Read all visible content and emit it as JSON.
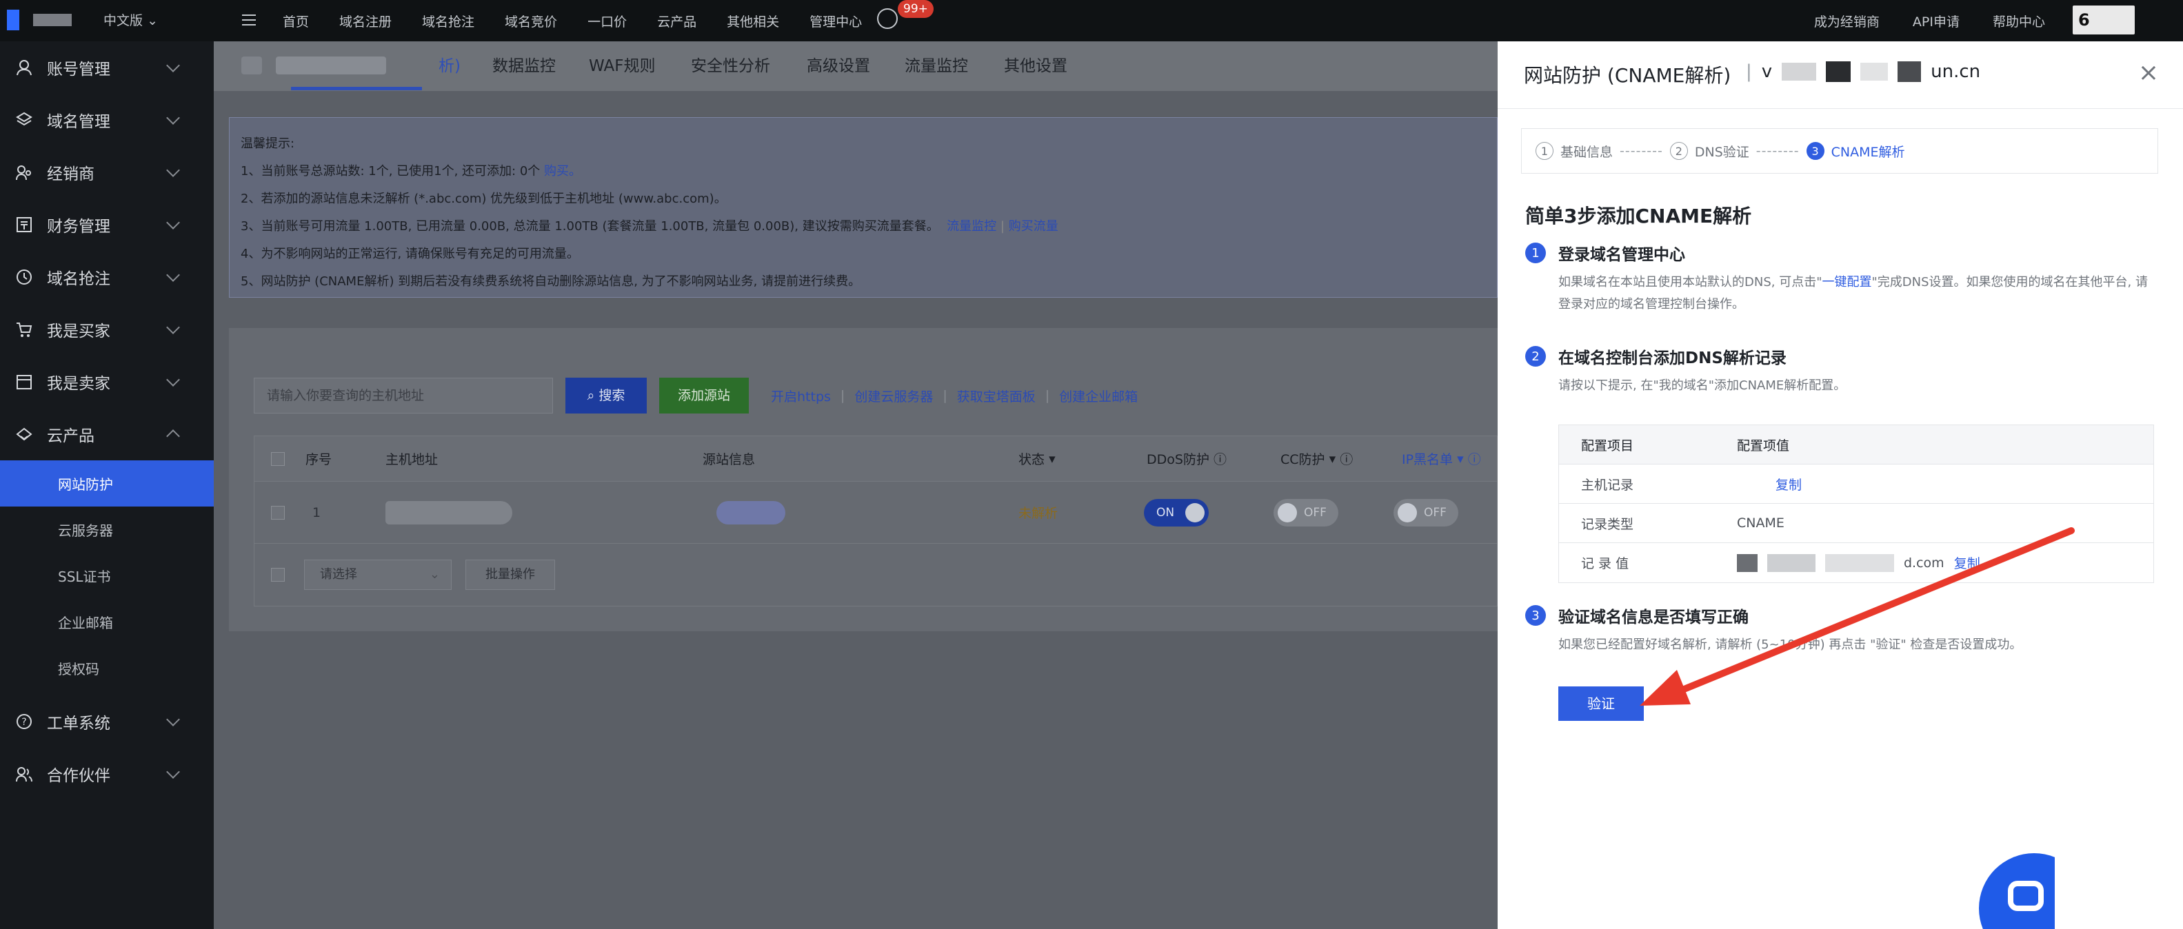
{
  "topbar": {
    "lang": "中文版",
    "nav": [
      "首页",
      "域名注册",
      "域名抢注",
      "域名竞价",
      "一口价",
      "云产品",
      "其他相关",
      "管理中心"
    ],
    "badge": "99+",
    "right_links": [
      "成为经销商",
      "API申请",
      "帮助中心"
    ],
    "avatar_text": "6"
  },
  "sidebar": {
    "items": [
      {
        "label": "账号管理",
        "icon": "user-icon"
      },
      {
        "label": "域名管理",
        "icon": "layers-icon"
      },
      {
        "label": "经销商",
        "icon": "people-icon"
      },
      {
        "label": "财务管理",
        "icon": "finance-icon"
      },
      {
        "label": "域名抢注",
        "icon": "clock-icon"
      },
      {
        "label": "我是买家",
        "icon": "cart-icon"
      },
      {
        "label": "我是卖家",
        "icon": "store-icon"
      },
      {
        "label": "云产品",
        "icon": "cloud-icon"
      }
    ],
    "sub_items": [
      "网站防护",
      "云服务器",
      "SSL证书",
      "企业邮箱",
      "授权码"
    ],
    "bottom_items": [
      {
        "label": "工单系统",
        "icon": "question-icon"
      },
      {
        "label": "合作伙伴",
        "icon": "partner-icon"
      }
    ]
  },
  "tabs": {
    "first_tab_suffix": "析)",
    "items": [
      "数据监控",
      "WAF规则",
      "安全性分析",
      "高级设置",
      "流量监控",
      "其他设置"
    ]
  },
  "tips": {
    "title": "温馨提示:",
    "lines": [
      "1、当前账号总源站数: 1个, 已使用1个, 还可添加: 0个",
      "2、若添加的源站信息未泛解析 (*.abc.com) 优先级到低于主机地址 (www.abc.com)。",
      "3、当前账号可用流量 1.00TB, 已用流量 0.00B, 总流量 1.00TB (套餐流量 1.00TB, 流量包 0.00B), 建议按需购买流量套餐。",
      "4、为不影响网站的正常运行, 请确保账号有充足的可用流量。",
      "5、网站防护 (CNAME解析) 到期后若没有续费系统将自动删除源站信息, 为了不影响网站业务, 请提前进行续费。"
    ],
    "buy_link": "购买。",
    "traffic_link": "流量监控",
    "buy_traffic_link": "购买流量"
  },
  "toolbar": {
    "search_placeholder": "请输入你要查询的主机地址",
    "search_label": "搜索",
    "add_label": "添加源站",
    "links": [
      "开启https",
      "创建云服务器",
      "获取宝塔面板",
      "创建企业邮箱"
    ]
  },
  "table": {
    "headers": [
      "序号",
      "主机地址",
      "源站信息",
      "状态",
      "DDoS防护",
      "CC防护",
      "IP黑名单"
    ],
    "row": {
      "index": "1",
      "status": "未解析",
      "ddos": "ON",
      "cc": "OFF",
      "ip": "OFF"
    },
    "select_placeholder": "请选择",
    "batch_label": "批量操作"
  },
  "drawer": {
    "title": "网站防护 (CNAME解析)",
    "domain_prefix": "v",
    "domain_suffix": "un.cn",
    "steps": [
      {
        "num": "1",
        "label": "基础信息"
      },
      {
        "num": "2",
        "label": "DNS验证"
      },
      {
        "num": "3",
        "label": "CNAME解析"
      }
    ],
    "step_separator": "--------",
    "section_title": "简单3步添加CNAME解析",
    "step1": {
      "num": "1",
      "title": "登录域名管理中心",
      "desc_before": "如果域名在本站且使用本站默认的DNS, 可点击\"",
      "desc_link": "一键配置",
      "desc_after": "\"完成DNS设置。如果您使用的域名在其他平台, 请登录对应的域名管理控制台操作。"
    },
    "step2": {
      "num": "2",
      "title": "在域名控制台添加DNS解析记录",
      "desc": "请按以下提示, 在\"我的域名\"添加CNAME解析配置。"
    },
    "config": {
      "header": [
        "配置项目",
        "配置项值"
      ],
      "rows": [
        {
          "label": "主机记录",
          "value": "",
          "link": "复制"
        },
        {
          "label": "记录类型",
          "value": "CNAME",
          "link": ""
        },
        {
          "label": "记 录 值",
          "value": "d.com",
          "link": "复制"
        }
      ]
    },
    "step3": {
      "num": "3",
      "title": "验证域名信息是否填写正确",
      "desc": "如果您已经配置好域名解析, 请解析 (5~10分钟) 再点击 \"验证\" 检查是否设置成功。"
    },
    "verify_label": "验证"
  },
  "colors": {
    "accent": "#2f5de0",
    "annotation_arrow": "#e8392b"
  }
}
